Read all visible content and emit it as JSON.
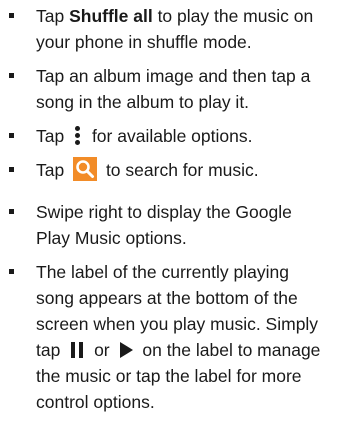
{
  "items": [
    {
      "lines": [
        {
          "before": "Tap ",
          "bold": "Shuffle all",
          "after": " to play the music on"
        },
        {
          "text": "your phone in shuffle mode."
        }
      ]
    },
    {
      "lines": [
        {
          "text": "Tap an album image and then tap a"
        },
        {
          "text": "song in the album to play it."
        }
      ]
    },
    {
      "lines": [
        {
          "before": "Tap ",
          "icon": "more-vert-icon",
          "after": " for available options."
        }
      ]
    },
    {
      "lines": [
        {
          "before": "Tap ",
          "icon": "search-icon",
          "after": " to search for music."
        }
      ]
    },
    {
      "lines": [
        {
          "text": "Swipe right to display the Google"
        },
        {
          "text": "Play Music options."
        }
      ]
    },
    {
      "lines": [
        {
          "text": "The label of the currently playing"
        },
        {
          "text": "song appears at the bottom of the"
        },
        {
          "text": "screen when you play music. Simply"
        },
        {
          "before": "tap ",
          "icon": "pause-icon",
          "middle": " or ",
          "icon2": "play-icon",
          "after": " on the label to manage"
        },
        {
          "text": "the music or tap the label for more"
        },
        {
          "text": "control options."
        }
      ]
    }
  ],
  "colors": {
    "text": "#1a1a1a",
    "search_icon_bg": "#f28c28",
    "background": "#ffffff"
  }
}
